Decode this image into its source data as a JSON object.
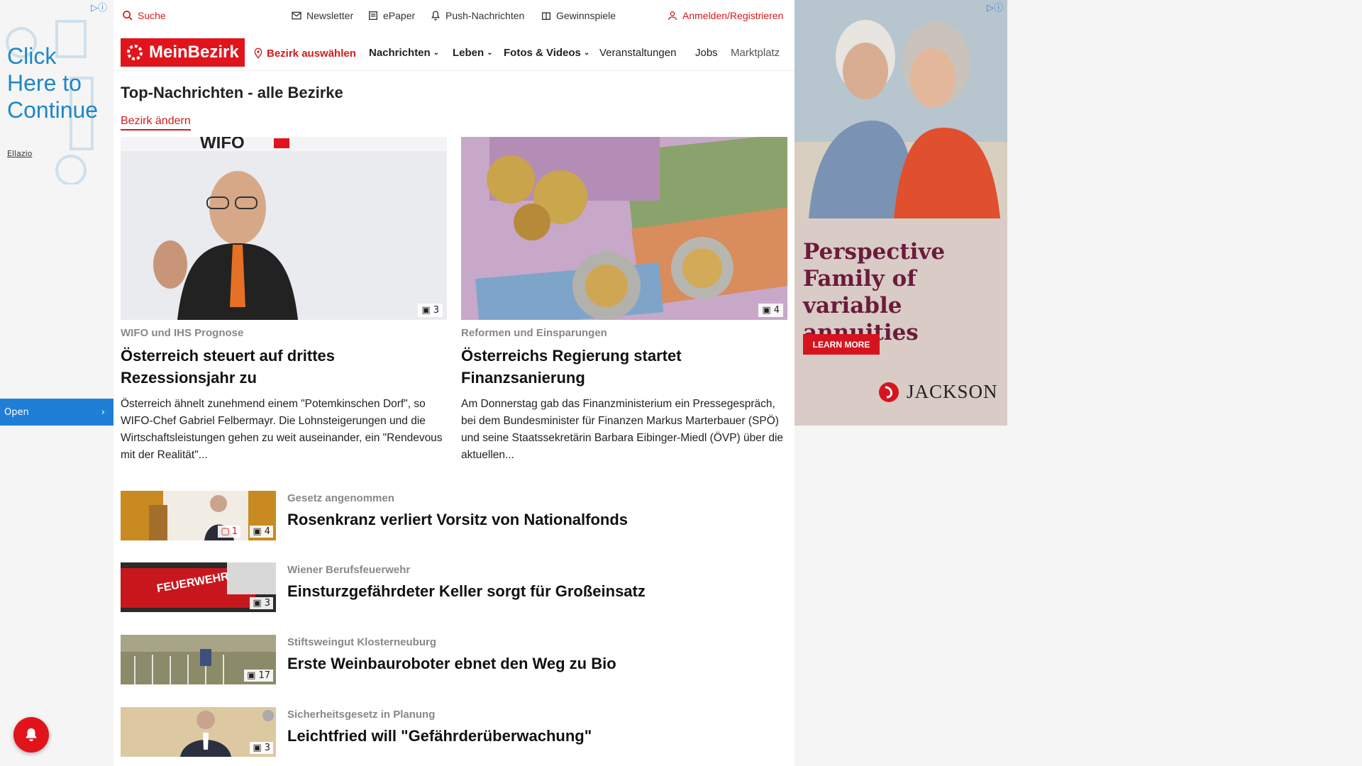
{
  "left_ad": {
    "adchoice": "▷ⓘ",
    "text": "Click Here to Continue",
    "brand": "Ellazio",
    "open_label": "Open"
  },
  "util_bar": {
    "search": "Suche",
    "newsletter": "Newsletter",
    "epaper": "ePaper",
    "push": "Push-Nachrichten",
    "games": "Gewinnspiele",
    "login": "Anmelden/Registrieren"
  },
  "nav": {
    "logo": "MeinBezirk",
    "district": "Bezirk auswählen",
    "news": "Nachrichten",
    "life": "Leben",
    "media": "Fotos & Videos",
    "events": "Veranstaltungen",
    "jobs": "Jobs",
    "market": "Marktplatz"
  },
  "section": {
    "title": "Top-Nachrichten - alle Bezirke",
    "change": "Bezirk ändern"
  },
  "featured": [
    {
      "kicker": "WIFO und IHS Prognose",
      "headline": "Österreich steuert auf drittes Rezessionsjahr zu",
      "lead": "Österreich ähnelt zunehmend einem \"Potemkinschen Dorf\", so WIFO-Chef Gabriel Felbermayr. Die Lohnsteigerungen und die Wirtschaftsleistungen gehen zu weit auseinander, ein \"Rendevous mit der Realität\"...",
      "images": "3",
      "image_caption": "WIFO"
    },
    {
      "kicker": "Reformen und Einsparungen",
      "headline": "Österreichs Regierung startet Finanzsanierung",
      "lead": "Am Donnerstag gab das Finanzministerium ein Pressegespräch, bei dem Bundesminister für Finanzen Markus Marterbauer (SPÖ) und seine Staatssekretärin Barbara Eibinger-Miedl (ÖVP) über die aktuellen...",
      "images": "4"
    }
  ],
  "list": [
    {
      "kicker": "Gesetz angenommen",
      "headline": "Rosenkranz verliert Vorsitz von Nationalfonds",
      "images": "4",
      "comments": "1"
    },
    {
      "kicker": "Wiener Berufsfeuerwehr",
      "headline": "Einsturzgefährdeter Keller sorgt für Großeinsatz",
      "images": "3",
      "truck_label": "FEUERWEHR"
    },
    {
      "kicker": "Stiftsweingut Klosterneuburg",
      "headline": "Erste Weinbauroboter ebnet den Weg zu Bio",
      "images": "17"
    },
    {
      "kicker": "Sicherheitsgesetz in Planung",
      "headline": "Leichtfried will \"Gefährderüberwachung\"",
      "images": "3"
    }
  ],
  "right_ad": {
    "adchoice": "▷ⓘ",
    "headline": "Perspective Family of variable annuities",
    "cta": "LEARN MORE",
    "brand": "JACKSON"
  },
  "colors": {
    "brand_red": "#e2141b",
    "ad_bg": "#d9cbc6",
    "ad_headline": "#6b1b3b"
  }
}
